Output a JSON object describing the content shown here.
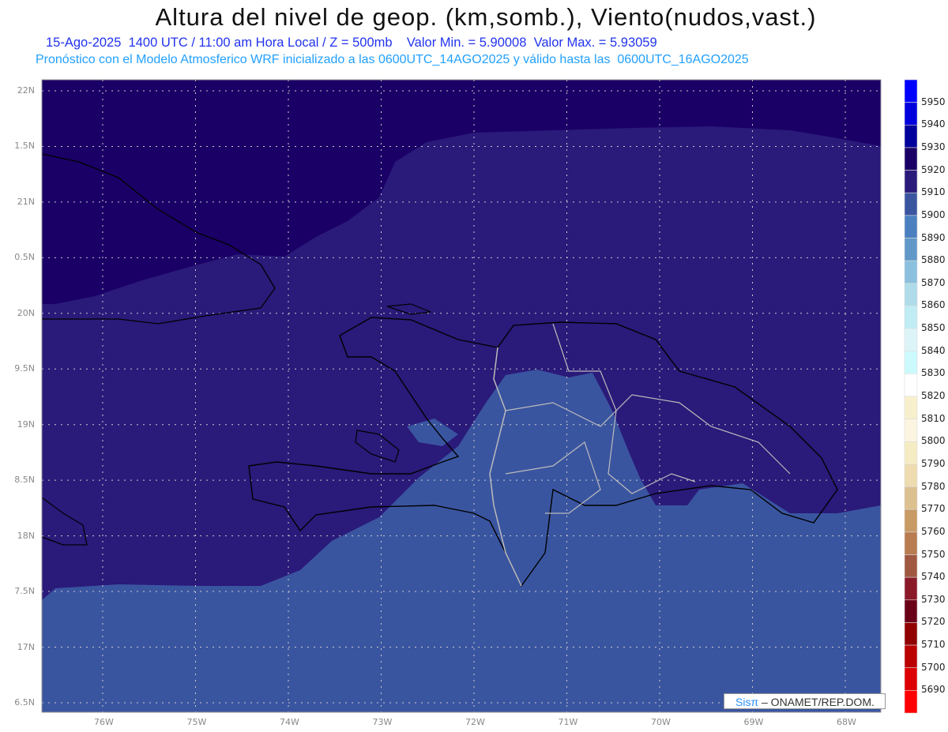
{
  "title": "Altura del nivel de geop. (km,somb.), Viento(nudos,vast.)",
  "subtitle_line1": "15-Ago-2025  1400 UTC / 11:00 am Hora Local / Z = 500mb    Valor Min. = 5.90008  Valor Max. = 5.93059",
  "subtitle_line2": "Pronóstico con el Modelo Atmosferico WRF inicializado a las 0600UTC_14AGO2025 y válido hasta las  0600UTC_16AGO2025",
  "credit": {
    "brand": "Sisπ",
    "text": " – ONAMET/REP.DOM."
  },
  "lon_ticks": [
    "76W",
    "75W",
    "74W",
    "73W",
    "72W",
    "71W",
    "70W",
    "69W",
    "68W"
  ],
  "lat_ticks": [
    "22N",
    "1.5N",
    "21N",
    "0.5N",
    "20N",
    "9.5N",
    "19N",
    "8.5N",
    "18N",
    "7.5N",
    "17N",
    "6.5N"
  ],
  "colorbar": {
    "labels": [
      "5950",
      "5940",
      "5930",
      "5920",
      "5910",
      "5900",
      "5890",
      "5880",
      "5870",
      "5860",
      "5850",
      "5840",
      "5830",
      "5820",
      "5810",
      "5800",
      "5790",
      "5780",
      "5770",
      "5760",
      "5750",
      "5740",
      "5730",
      "5720",
      "5710",
      "5700",
      "5690"
    ],
    "colors": [
      "#0000ff",
      "#0000dd",
      "#00009a",
      "#1a0066",
      "#2a1a7a",
      "#3a55a0",
      "#4a80c0",
      "#6098c8",
      "#8cc0de",
      "#b0dcea",
      "#c0ecf4",
      "#dcf4f8",
      "#ccfafc",
      "#ffffff",
      "#f8f0cc",
      "#faf4e0",
      "#f6ecc4",
      "#eedcb0",
      "#dcc090",
      "#c89a64",
      "#b87c50",
      "#a05840",
      "#8a1a28",
      "#6a0018",
      "#900000",
      "#bb0000",
      "#dd0000",
      "#ff0000"
    ]
  },
  "field_colors": {
    "high": "#1a0066",
    "mid": "#2a1a7a",
    "low": "#3a55a0",
    "coast": "#000000",
    "provinces": "#bbbbbb"
  }
}
